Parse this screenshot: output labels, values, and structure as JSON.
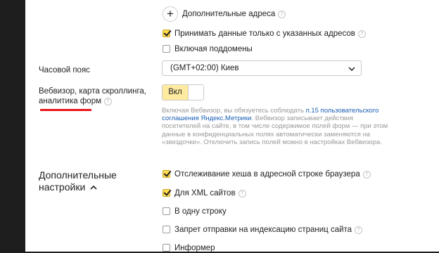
{
  "additional_addresses": {
    "label": "Дополнительные адреса",
    "icon": "plus-icon",
    "help_icon": "?"
  },
  "only_listed_addresses": {
    "label": "Принимать данные только с указанных адресов",
    "checked": true,
    "help_icon": "?"
  },
  "include_subdomains": {
    "label": "Включая поддомены",
    "checked": false
  },
  "timezone": {
    "label": "Часовой пояс",
    "value": "(GMT+02:00) Киев"
  },
  "webvisor": {
    "label_line1": "Вебвизор, карта скроллинга,",
    "label_line2": "аналитика форм",
    "help_icon": "?",
    "toggle_label": "Вкл",
    "toggle_on": true,
    "desc_line1_pre": "Включая Вебвизор, вы обязуетесь соблюдать ",
    "desc_line1_link": "п.15 пользовательского",
    "desc_line2_link": "соглашения Яндекс.Метрики",
    "desc_line2_post": ". Вебвизор записывает действия",
    "desc_line3": "посетителей на сайте, в том числе содержимое полей форм — при этом",
    "desc_line4": "данные в конфиденциальных полях автоматически заменяются на",
    "desc_line5": "«звездочки». Отключить запись полей можно в настройках Вебвизора."
  },
  "additional_settings": {
    "heading_line1": "Дополнительные",
    "heading_line2": "настройки",
    "items": [
      {
        "label": "Отслеживание хеша в адресной строке браузера",
        "checked": true,
        "help_icon": "?"
      },
      {
        "label": "Для XML сайтов",
        "checked": true,
        "help_icon": "?"
      },
      {
        "label": "В одну строку",
        "checked": false
      },
      {
        "label": "Запрет отправки на индексацию страниц сайта",
        "checked": false,
        "help_icon": "?"
      },
      {
        "label": "Информер",
        "checked": false
      }
    ]
  },
  "colors": {
    "accent": "#ffdb4d",
    "toggle_on": "#ffeba0",
    "link": "#1a5fb4",
    "annotation": "#e8161a"
  }
}
